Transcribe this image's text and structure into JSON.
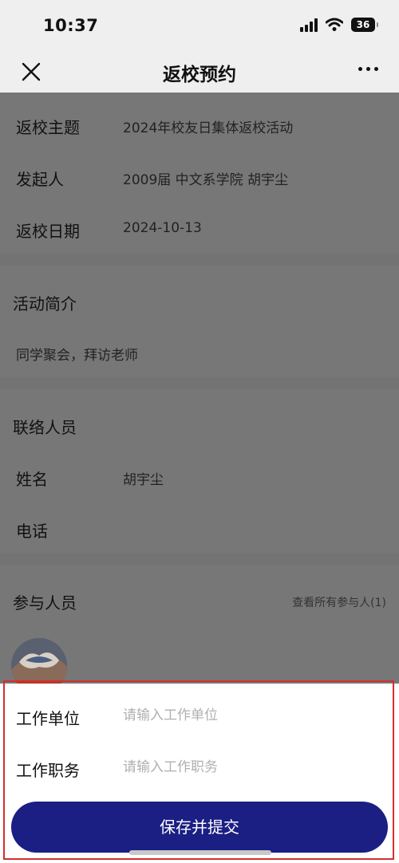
{
  "status_bar": {
    "time": "10:37",
    "battery": "36"
  },
  "nav": {
    "title": "返校预约"
  },
  "event": {
    "rows": [
      {
        "label": "返校主题",
        "value": "2024年校友日集体返校活动"
      },
      {
        "label": "发起人",
        "value": "2009届 中文系学院 胡宇尘"
      },
      {
        "label": "返校日期",
        "value": "2024-10-13"
      }
    ]
  },
  "intro": {
    "title": "活动简介",
    "text": "同学聚会，拜访老师"
  },
  "contact": {
    "title": "联络人员",
    "name_label": "姓名",
    "name_value": "胡宇尘",
    "phone_label": "电话",
    "phone_value": ""
  },
  "participants": {
    "title": "参与人员",
    "link": "查看所有参与人(1)"
  },
  "form": {
    "work_unit_label": "工作单位",
    "work_unit_placeholder": "请输入工作单位",
    "work_title_label": "工作职务",
    "work_title_placeholder": "请输入工作职务",
    "submit_label": "保存并提交"
  },
  "colors": {
    "accent": "#1b1e83",
    "highlight_border": "#d0302d",
    "overlay": "#737373"
  }
}
